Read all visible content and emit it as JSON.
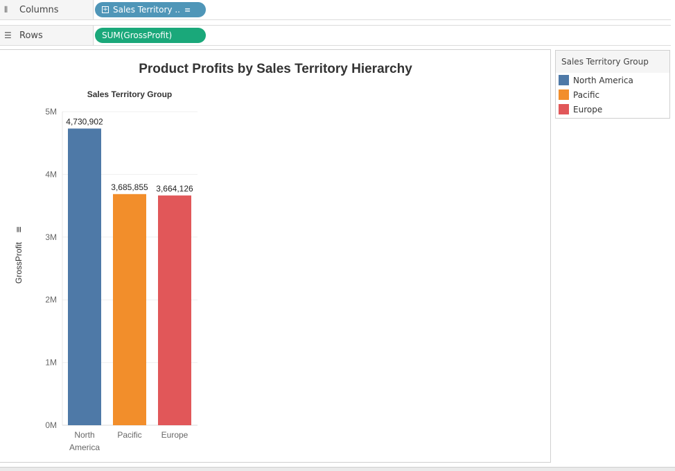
{
  "shelves": {
    "columns_label": "Columns",
    "rows_label": "Rows",
    "columns_pill": "Sales Territory ..",
    "rows_pill": "SUM(GrossProfit)"
  },
  "chart_data": {
    "type": "bar",
    "title": "Product Profits by Sales Territory Hierarchy",
    "header": "Sales Territory Group",
    "categories": [
      "North America",
      "Pacific",
      "Europe"
    ],
    "category_lines": [
      [
        "North",
        "America"
      ],
      [
        "Pacific"
      ],
      [
        "Europe"
      ]
    ],
    "values": [
      4730902,
      3685855,
      3664126
    ],
    "value_labels": [
      "4,730,902",
      "3,685,855",
      "3,664,126"
    ],
    "colors": [
      "#4e79a7",
      "#f28e2b",
      "#e15759"
    ],
    "ylabel": "GrossProfit",
    "ylim": [
      0,
      5000000
    ],
    "yticks": [
      0,
      1000000,
      2000000,
      3000000,
      4000000,
      5000000
    ],
    "ytick_labels": [
      "0M",
      "1M",
      "2M",
      "3M",
      "4M",
      "5M"
    ],
    "grid": true
  },
  "legend": {
    "title": "Sales Territory Group",
    "items": [
      {
        "label": "North America",
        "color": "#4e79a7"
      },
      {
        "label": "Pacific",
        "color": "#f28e2b"
      },
      {
        "label": "Europe",
        "color": "#e15759"
      }
    ]
  }
}
